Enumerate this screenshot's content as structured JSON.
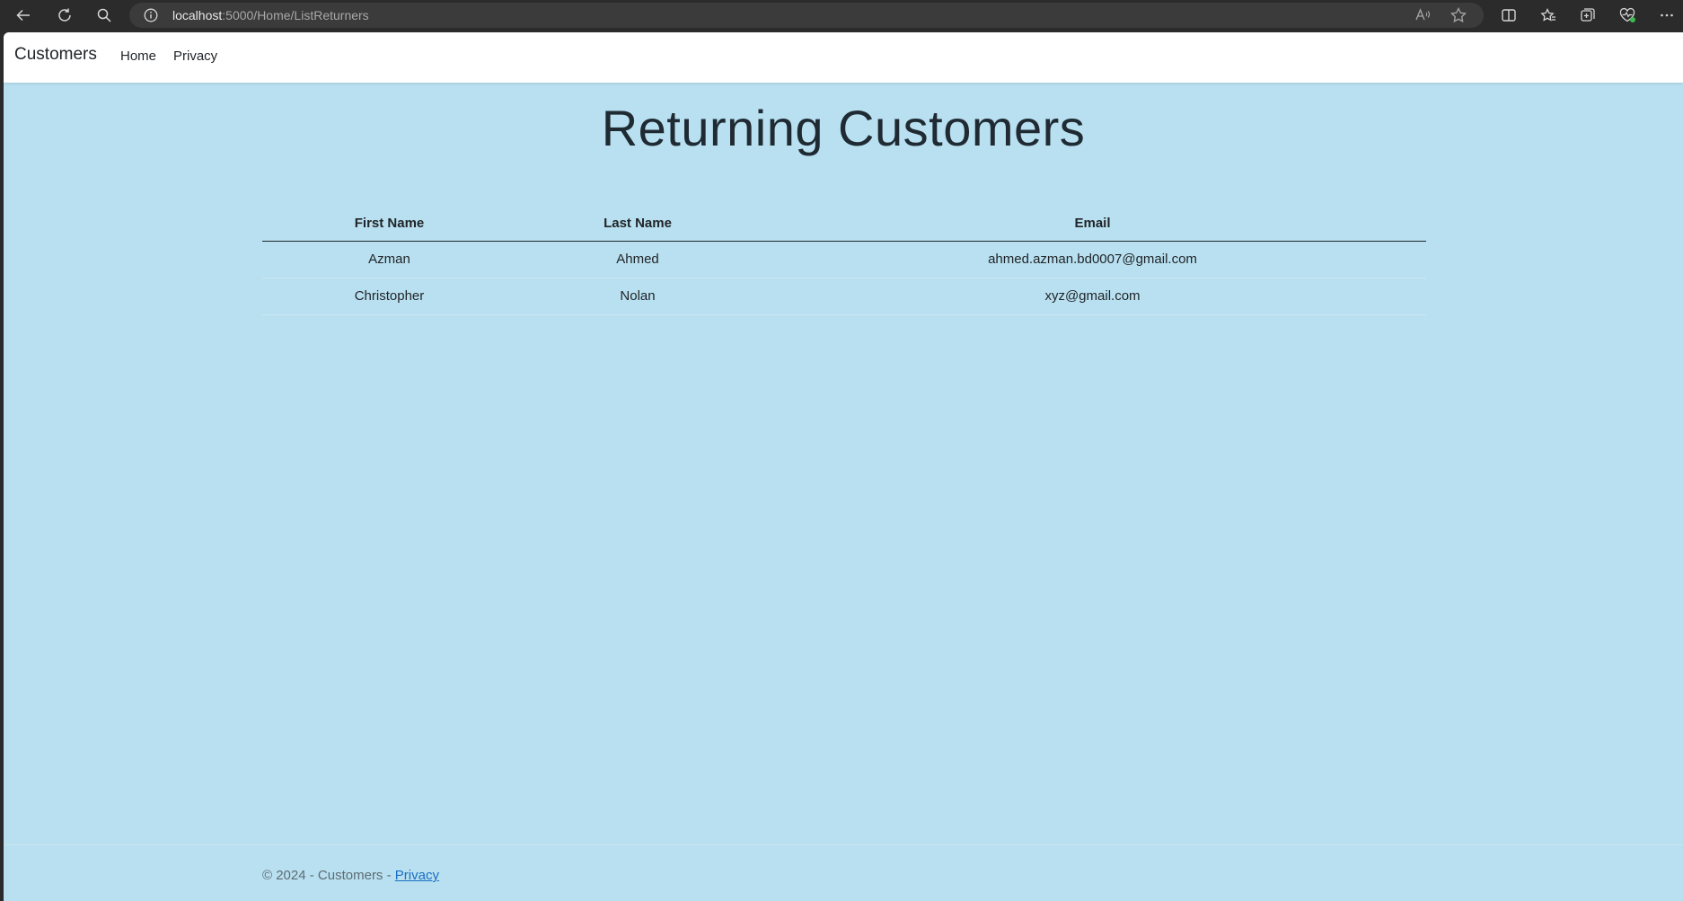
{
  "browser": {
    "url_host": "localhost",
    "url_rest": ":5000/Home/ListReturners"
  },
  "navbar": {
    "brand": "Customers",
    "links": [
      {
        "label": "Home"
      },
      {
        "label": "Privacy"
      }
    ]
  },
  "main": {
    "heading": "Returning Customers",
    "table": {
      "headers": [
        "First Name",
        "Last Name",
        "Email"
      ],
      "rows": [
        [
          "Azman",
          "Ahmed",
          "ahmed.azman.bd0007@gmail.com"
        ],
        [
          "Christopher",
          "Nolan",
          "xyz@gmail.com"
        ]
      ]
    }
  },
  "footer": {
    "prefix": "© 2024 - Customers - ",
    "privacy_link": "Privacy"
  },
  "colors": {
    "page_background": "#b8e0f0",
    "navbar_background": "#ffffff",
    "link": "#1a6fc4"
  },
  "icons": [
    "back-icon",
    "refresh-icon",
    "search-icon",
    "info-icon",
    "read-aloud-icon",
    "favorite-star-icon",
    "split-screen-icon",
    "favorites-icon",
    "collections-icon",
    "browser-essentials-icon",
    "more-icon"
  ]
}
